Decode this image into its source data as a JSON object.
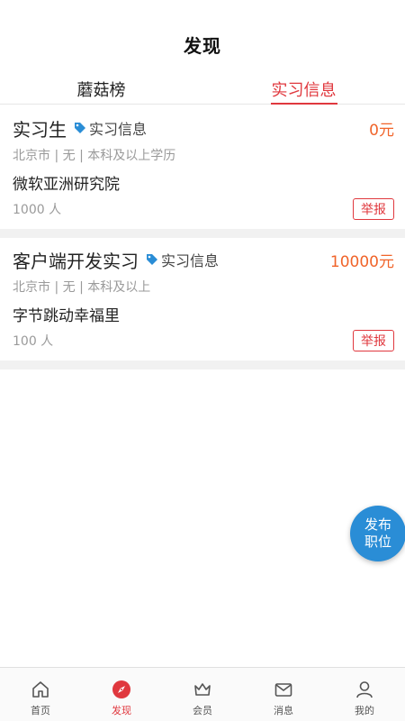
{
  "header": {
    "title": "发现"
  },
  "tabs": [
    {
      "label": "蘑菇榜",
      "active": false
    },
    {
      "label": "实习信息",
      "active": true
    }
  ],
  "jobs": [
    {
      "title": "实习生",
      "tag": "实习信息",
      "salary": "0元",
      "meta": "北京市 | 无 | 本科及以上学历",
      "company": "微软亚洲研究院",
      "count": "1000 人",
      "report": "举报"
    },
    {
      "title": "客户端开发实习",
      "tag": "实习信息",
      "salary": "10000元",
      "meta": "北京市 | 无 | 本科及以上",
      "company": "字节跳动幸福里",
      "count": "100 人",
      "report": "举报"
    }
  ],
  "fab": {
    "line1": "发布",
    "line2": "职位"
  },
  "bottom_nav": [
    {
      "label": "首页",
      "icon": "home-icon"
    },
    {
      "label": "发现",
      "icon": "compass-icon",
      "active": true
    },
    {
      "label": "会员",
      "icon": "crown-icon"
    },
    {
      "label": "消息",
      "icon": "mail-icon"
    },
    {
      "label": "我的",
      "icon": "user-icon"
    }
  ],
  "colors": {
    "accent": "#e0383e",
    "salary": "#f0642a",
    "fab": "#2a8dd6",
    "tag_icon": "#2a8dd6"
  }
}
